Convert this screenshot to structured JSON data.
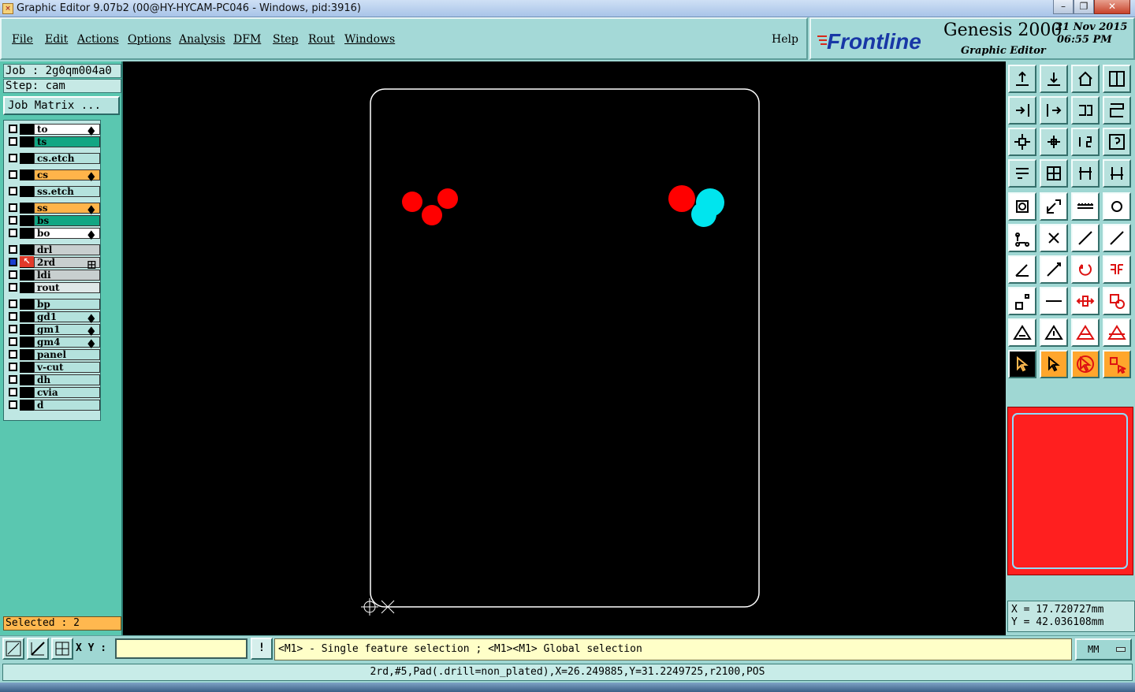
{
  "window": {
    "title": "Graphic Editor 9.07b2 (00@HY-HYCAM-PC046 - Windows, pid:3916)"
  },
  "menu": [
    "File",
    "Edit",
    "Actions",
    "Options",
    "Analysis",
    "DFM",
    "Step",
    "Rout",
    "Windows"
  ],
  "help_label": "Help",
  "brand": {
    "logo": "Frontline",
    "product": "Genesis 2000",
    "subtitle": "Graphic Editor",
    "date": "21 Nov 2015",
    "time": "06:55 PM"
  },
  "job": {
    "job_line": "Job : 2g0qm004a0",
    "step_line": "Step: cam",
    "matrix_label": "Job Matrix ..."
  },
  "layers": [
    {
      "name": "to",
      "color": "#ffffff",
      "mark": "♦"
    },
    {
      "name": "ts",
      "color": "#12a683",
      "mark": ""
    },
    {
      "name": "cs.etch",
      "color": "#b4e2dd",
      "mark": ""
    },
    {
      "name": "cs",
      "color": "#ffb44a",
      "mark": "♦"
    },
    {
      "name": "ss.etch",
      "color": "#b4e2dd",
      "mark": ""
    },
    {
      "name": "ss",
      "color": "#ffb44a",
      "mark": "♦"
    },
    {
      "name": "bs",
      "color": "#12a683",
      "mark": ""
    },
    {
      "name": "bo",
      "color": "#ffffff",
      "mark": "♦"
    },
    {
      "name": "drl",
      "color": "#c8cfcf",
      "mark": ""
    },
    {
      "name": "2rd",
      "color": "#c8cfcf",
      "mark": "⊞"
    },
    {
      "name": "ldi",
      "color": "#c8cfcf",
      "mark": ""
    },
    {
      "name": "rout",
      "color": "#dfe8e8",
      "mark": ""
    },
    {
      "name": "bp",
      "color": "#b4e2dd",
      "mark": ""
    },
    {
      "name": "gd1",
      "color": "#b4e2dd",
      "mark": "♦"
    },
    {
      "name": "gm1",
      "color": "#b4e2dd",
      "mark": "♦"
    },
    {
      "name": "gm4",
      "color": "#b4e2dd",
      "mark": "♦"
    },
    {
      "name": "panel",
      "color": "#b4e2dd",
      "mark": ""
    },
    {
      "name": "v-cut",
      "color": "#b4e2dd",
      "mark": ""
    },
    {
      "name": "dh",
      "color": "#b4e2dd",
      "mark": ""
    },
    {
      "name": "cvia",
      "color": "#b4e2dd",
      "mark": ""
    },
    {
      "name": "d",
      "color": "#b4e2dd",
      "mark": ""
    }
  ],
  "selected_label": "Selected : 2",
  "coords": {
    "x": "X = 17.720727mm",
    "y": "Y = 42.036108mm"
  },
  "status": {
    "xy_label": "X Y :",
    "xy_value": "",
    "hint": "<M1> - Single feature selection ; <M1><M1> Global selection",
    "unit": "MM",
    "info": "2rd,#5,Pad(.drill=non_plated),X=26.249885,Y=31.2249725,r2100,POS"
  },
  "colors": {
    "pad_red": "#ff0000",
    "pad_cyan": "#00e5ee",
    "profile": "#ffffff",
    "preview": "#ff1f1f"
  }
}
